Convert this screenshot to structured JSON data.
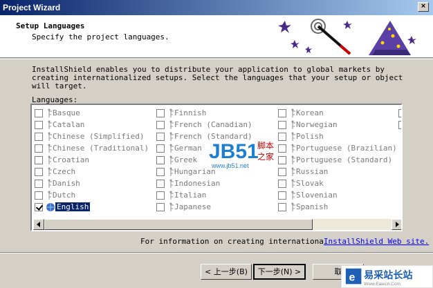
{
  "window": {
    "title": "Project Wizard",
    "close_glyph": "×"
  },
  "header": {
    "title": "Setup Languages",
    "subtitle": "Specify the project languages."
  },
  "intro": "InstallShield enables you to distribute your application to global markets by creating internationalized setups.  Select the languages that your setup or object will target.",
  "languages_label": "Languages:",
  "languages": [
    {
      "label": "Basque",
      "checked": false
    },
    {
      "label": "Catalan",
      "checked": false
    },
    {
      "label": "Chinese (Simplified)",
      "checked": false
    },
    {
      "label": "Chinese (Traditional)",
      "checked": false
    },
    {
      "label": "Croatian",
      "checked": false
    },
    {
      "label": "Czech",
      "checked": false
    },
    {
      "label": "Danish",
      "checked": false
    },
    {
      "label": "Dutch",
      "checked": false
    },
    {
      "label": "English",
      "checked": true,
      "selected": true
    },
    {
      "label": "Finnish",
      "checked": false
    },
    {
      "label": "French (Canadian)",
      "checked": false
    },
    {
      "label": "French (Standard)",
      "checked": false
    },
    {
      "label": "German",
      "checked": false
    },
    {
      "label": "Greek",
      "checked": false
    },
    {
      "label": "Hungarian",
      "checked": false
    },
    {
      "label": "Indonesian",
      "checked": false
    },
    {
      "label": "Italian",
      "checked": false
    },
    {
      "label": "Japanese",
      "checked": false
    },
    {
      "label": "Korean",
      "checked": false
    },
    {
      "label": "Norwegian",
      "checked": false
    },
    {
      "label": "Polish",
      "checked": false
    },
    {
      "label": "Portuguese (Brazilian)",
      "checked": false
    },
    {
      "label": "Portuguese (Standard)",
      "checked": false
    },
    {
      "label": "Russian",
      "checked": false
    },
    {
      "label": "Slovak",
      "checked": false
    },
    {
      "label": "Slovenian",
      "checked": false
    },
    {
      "label": "Spanish",
      "checked": false
    }
  ],
  "info": {
    "text": "For information on creating internationa",
    "link": "InstallShield Web site."
  },
  "buttons": {
    "back": "< 上一步(B)",
    "next": "下一步(N) >",
    "cancel": "取"
  },
  "watermark": {
    "brand": "JB51",
    "cn_top": "脚本",
    "cn_bottom": "之家",
    "url": "www.jb51.net",
    "site_name": "易采站长站",
    "site_url": "Www.Eaiecn.Com"
  },
  "colors": {
    "title_bar": "#0a246a",
    "selection": "#0a246a",
    "link": "#0000ff",
    "dialog": "#d4d0c8"
  }
}
